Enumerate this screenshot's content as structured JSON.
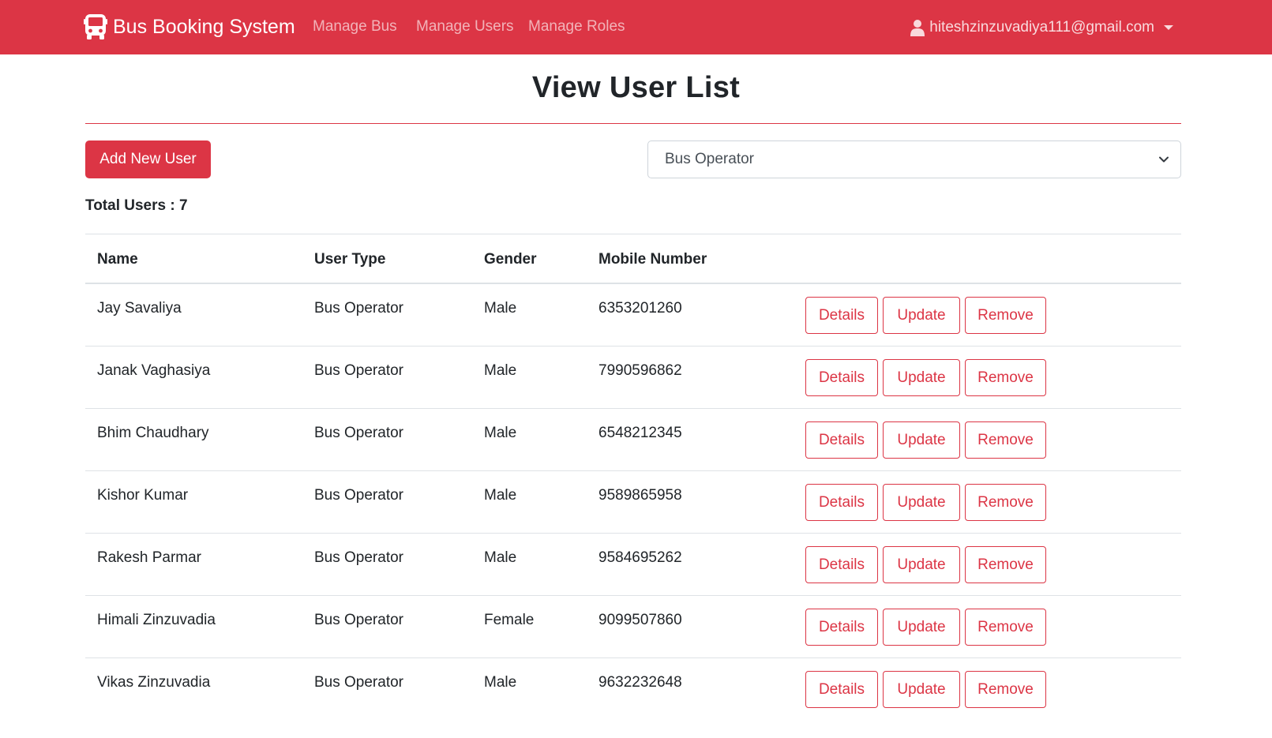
{
  "navbar": {
    "brand": "Bus Booking System",
    "links": [
      "Manage Bus",
      "Manage Users",
      "Manage Roles"
    ],
    "user_email": "hiteshzinzuvadiya111@gmail.com"
  },
  "page": {
    "title": "View User List",
    "add_button": "Add New User",
    "filter_selected": "Bus Operator",
    "total_label": "Total Users : 7"
  },
  "table": {
    "headers": [
      "Name",
      "User Type",
      "Gender",
      "Mobile Number"
    ],
    "action_labels": {
      "details": "Details",
      "update": "Update",
      "remove": "Remove"
    },
    "rows": [
      {
        "name": "Jay Savaliya",
        "type": "Bus Operator",
        "gender": "Male",
        "mobile": "6353201260"
      },
      {
        "name": "Janak Vaghasiya",
        "type": "Bus Operator",
        "gender": "Male",
        "mobile": "7990596862"
      },
      {
        "name": "Bhim Chaudhary",
        "type": "Bus Operator",
        "gender": "Male",
        "mobile": "6548212345"
      },
      {
        "name": "Kishor Kumar",
        "type": "Bus Operator",
        "gender": "Male",
        "mobile": "9589865958"
      },
      {
        "name": "Rakesh Parmar",
        "type": "Bus Operator",
        "gender": "Male",
        "mobile": "9584695262"
      },
      {
        "name": "Himali Zinzuvadia",
        "type": "Bus Operator",
        "gender": "Female",
        "mobile": "9099507860"
      },
      {
        "name": "Vikas Zinzuvadia",
        "type": "Bus Operator",
        "gender": "Male",
        "mobile": "9632232648"
      }
    ]
  },
  "colors": {
    "accent": "#dc3545",
    "text": "#212529",
    "border": "#dee2e6"
  },
  "icons": {
    "brand": "bus-icon",
    "user": "user-icon",
    "dropdown": "chevron-down-icon"
  }
}
